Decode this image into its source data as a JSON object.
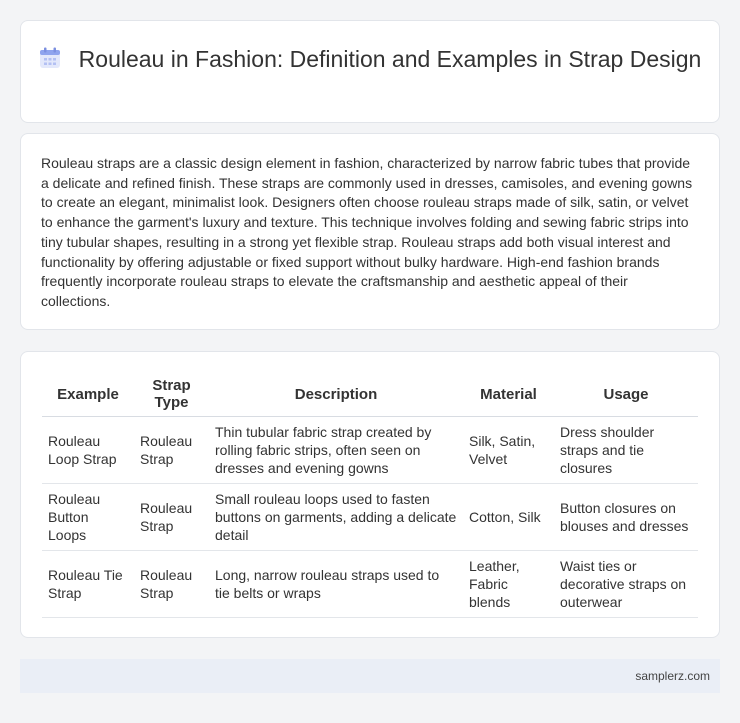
{
  "header": {
    "icon": "calendar-icon",
    "title": "Rouleau in Fashion: Definition and Examples in Strap Design"
  },
  "intro": {
    "text": "Rouleau straps are a classic design element in fashion, characterized by narrow fabric tubes that provide a delicate and refined finish. These straps are commonly used in dresses, camisoles, and evening gowns to create an elegant, minimalist look. Designers often choose rouleau straps made of silk, satin, or velvet to enhance the garment's luxury and texture. This technique involves folding and sewing fabric strips into tiny tubular shapes, resulting in a strong yet flexible strap. Rouleau straps add both visual interest and functionality by offering adjustable or fixed support without bulky hardware. High-end fashion brands frequently incorporate rouleau straps to elevate the craftsmanship and aesthetic appeal of their collections."
  },
  "table": {
    "headers": [
      "Example",
      "Strap Type",
      "Description",
      "Material",
      "Usage"
    ],
    "rows": [
      [
        "Rouleau Loop Strap",
        "Rouleau Strap",
        "Thin tubular fabric strap created by rolling fabric strips, often seen on dresses and evening gowns",
        "Silk, Satin, Velvet",
        "Dress shoulder straps and tie closures"
      ],
      [
        "Rouleau Button Loops",
        "Rouleau Strap",
        "Small rouleau loops used to fasten buttons on garments, adding a delicate detail",
        "Cotton, Silk",
        "Button closures on blouses and dresses"
      ],
      [
        "Rouleau Tie Strap",
        "Rouleau Strap",
        "Long, narrow rouleau straps used to tie belts or wraps",
        "Leather, Fabric blends",
        "Waist ties or decorative straps on outerwear"
      ]
    ]
  },
  "footer": {
    "site": "samplerz.com"
  }
}
